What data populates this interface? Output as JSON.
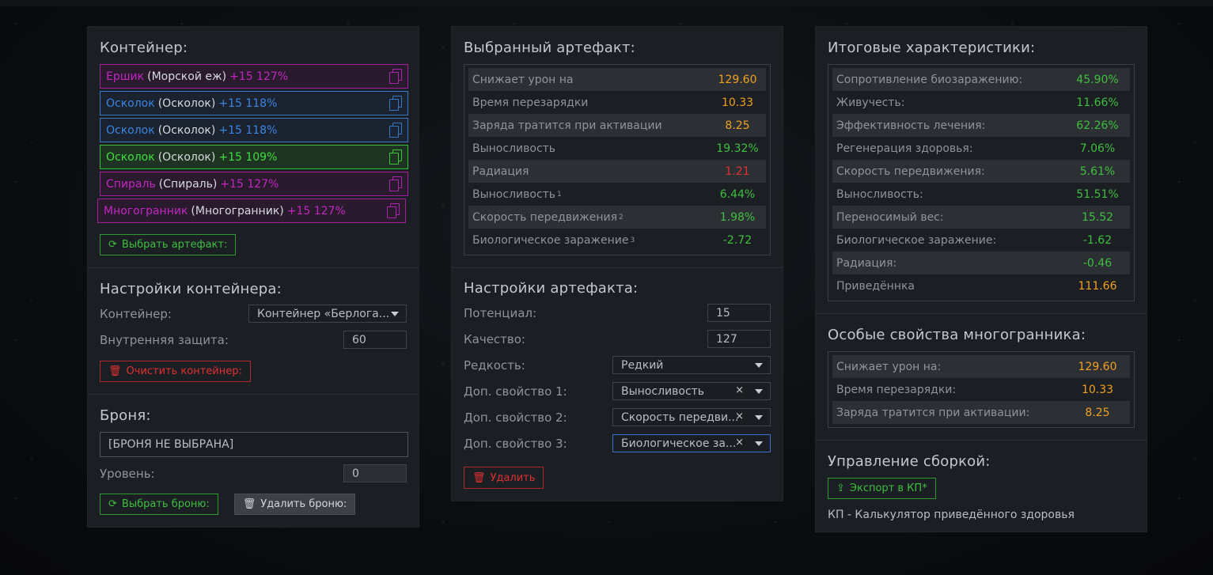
{
  "colors": {
    "accent_green": "#3fbf3f",
    "danger": "#e03131",
    "orange": "#f0a020",
    "purple": "#c028c0",
    "blue": "#3a86e0"
  },
  "container": {
    "title": "Контейнер:",
    "artifacts": [
      {
        "name": "Ершик",
        "base": "(Морской еж)",
        "level": "+15 127%",
        "rarity": "purple"
      },
      {
        "name": "Осколок",
        "base": "(Осколок)",
        "level": "+15 118%",
        "rarity": "blue"
      },
      {
        "name": "Осколок",
        "base": "(Осколок)",
        "level": "+15 118%",
        "rarity": "blue"
      },
      {
        "name": "Осколок",
        "base": "(Осколок)",
        "level": "+15 109%",
        "rarity": "green"
      },
      {
        "name": "Спираль",
        "base": "(Спираль)",
        "level": "+15 127%",
        "rarity": "purple"
      },
      {
        "name": "Многогранник",
        "base": "(Многогранник)",
        "level": "+15 127%",
        "rarity": "purple"
      }
    ],
    "choose_button": "Выбрать артефакт:"
  },
  "container_settings": {
    "title": "Настройки контейнера:",
    "container_label": "Контейнер:",
    "container_value": "Контейнер «Берлога...",
    "protection_label": "Внутренняя защита:",
    "protection_value": "60",
    "clear_button": "Очистить контейнер:"
  },
  "armor": {
    "title": "Броня:",
    "value": "[БРОНЯ НЕ ВЫБРАНА]",
    "level_label": "Уровень:",
    "level_value": "0",
    "choose_button": "Выбрать броню:",
    "delete_button": "Удалить броню:"
  },
  "selected_artifact": {
    "title": "Выбранный артефакт:",
    "stats": [
      {
        "label": "Снижает урон на",
        "sup": "",
        "value": "129.60",
        "color": "#f0a020"
      },
      {
        "label": "Время перезарядки",
        "sup": "",
        "value": "10.33",
        "color": "#f0a020"
      },
      {
        "label": "Заряда тратится при активации",
        "sup": "",
        "value": "8.25",
        "color": "#f0a020"
      },
      {
        "label": "Выносливость",
        "sup": "",
        "value": "19.32%",
        "color": "#3fbf3f"
      },
      {
        "label": "Радиация",
        "sup": "",
        "value": "1.21",
        "color": "#e03131"
      },
      {
        "label": "Выносливость",
        "sup": "1",
        "value": "6.44%",
        "color": "#3fbf3f"
      },
      {
        "label": "Скорость передвижения",
        "sup": "2",
        "value": "1.98%",
        "color": "#3fbf3f"
      },
      {
        "label": "Биологическое заражение",
        "sup": "3",
        "value": "-2.72",
        "color": "#3fbf3f"
      }
    ]
  },
  "artifact_settings": {
    "title": "Настройки артефакта:",
    "potential_label": "Потенциал:",
    "potential_value": "15",
    "quality_label": "Качество:",
    "quality_value": "127",
    "rarity_label": "Редкость:",
    "rarity_value": "Редкий",
    "prop1_label": "Доп. свойство 1:",
    "prop1_value": "Выносливость",
    "prop2_label": "Доп. свойство 2:",
    "prop2_value": "Скорость передви...",
    "prop3_label": "Доп. свойство 3:",
    "prop3_value": "Биологическое за...",
    "clear_x": "×",
    "delete_button": "Удалить"
  },
  "totals": {
    "title": "Итоговые характеристики:",
    "stats": [
      {
        "label": "Сопротивление биозаражению:",
        "value": "45.90%",
        "color": "#3fbf3f"
      },
      {
        "label": "Живучесть:",
        "value": "11.66%",
        "color": "#3fbf3f"
      },
      {
        "label": "Эффективность лечения:",
        "value": "62.26%",
        "color": "#3fbf3f"
      },
      {
        "label": "Регенерация здоровья:",
        "value": "7.06%",
        "color": "#3fbf3f"
      },
      {
        "label": "Скорость передвижения:",
        "value": "5.61%",
        "color": "#3fbf3f"
      },
      {
        "label": "Выносливость:",
        "value": "51.51%",
        "color": "#3fbf3f"
      },
      {
        "label": "Переносимый вес:",
        "value": "15.52",
        "color": "#3fbf3f"
      },
      {
        "label": "Биологическое заражение:",
        "value": "-1.62",
        "color": "#3fbf3f"
      },
      {
        "label": "Радиация:",
        "value": "-0.46",
        "color": "#3fbf3f"
      },
      {
        "label": "Приведённка",
        "value": "111.66",
        "color": "#f0a020"
      }
    ]
  },
  "special": {
    "title": "Особые свойства многогранника:",
    "stats": [
      {
        "label": "Снижает урон на:",
        "value": "129.60",
        "color": "#f0a020"
      },
      {
        "label": "Время перезарядки:",
        "value": "10.33",
        "color": "#f0a020"
      },
      {
        "label": "Заряда тратится при активации:",
        "value": "8.25",
        "color": "#f0a020"
      }
    ]
  },
  "build": {
    "title": "Управление сборкой:",
    "export_button": "Экспорт в КП*",
    "note": "КП - Калькулятор приведённого здоровья"
  }
}
